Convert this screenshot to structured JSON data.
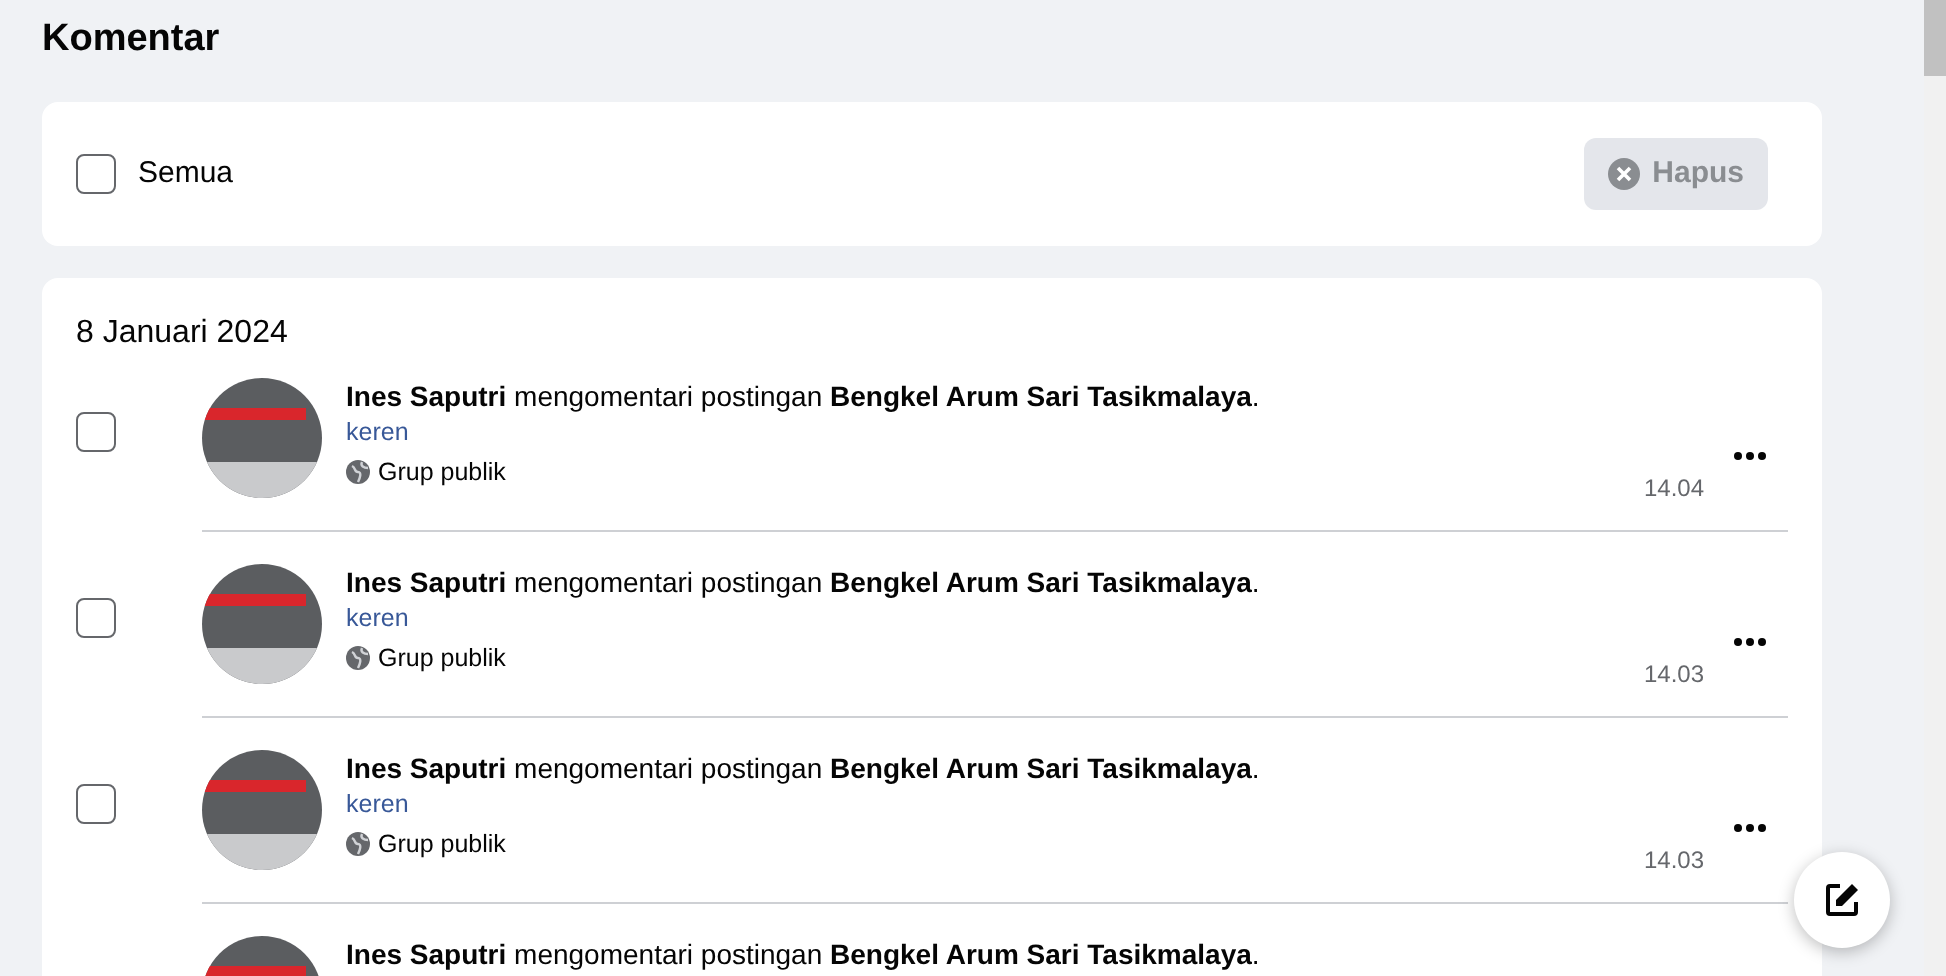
{
  "page_title": "Komentar",
  "toolbar": {
    "select_all": {
      "label": "Semua",
      "checked": false
    },
    "delete_button": {
      "label": "Hapus",
      "disabled": true
    }
  },
  "groups": [
    {
      "date": "8 Januari 2024",
      "items": [
        {
          "checked": false,
          "text": "**Ines Saputri** mengomentari postingan **Bengkel Arum Sari Tasikmalaya**.",
          "comment": "keren",
          "audience": "Grup publik",
          "time": "14.04"
        },
        {
          "checked": false,
          "text": "**Ines Saputri** mengomentari postingan **Bengkel Arum Sari Tasikmalaya**.",
          "comment": "keren",
          "audience": "Grup publik",
          "time": "14.03"
        },
        {
          "checked": false,
          "text": "**Ines Saputri** mengomentari postingan **Bengkel Arum Sari Tasikmalaya**.",
          "comment": "keren",
          "audience": "Grup publik",
          "time": "14.03"
        },
        {
          "text": "**Ines Saputri** mengomentari postingan **Bengkel Arum Sari Tasikmalaya**."
        }
      ]
    }
  ]
}
